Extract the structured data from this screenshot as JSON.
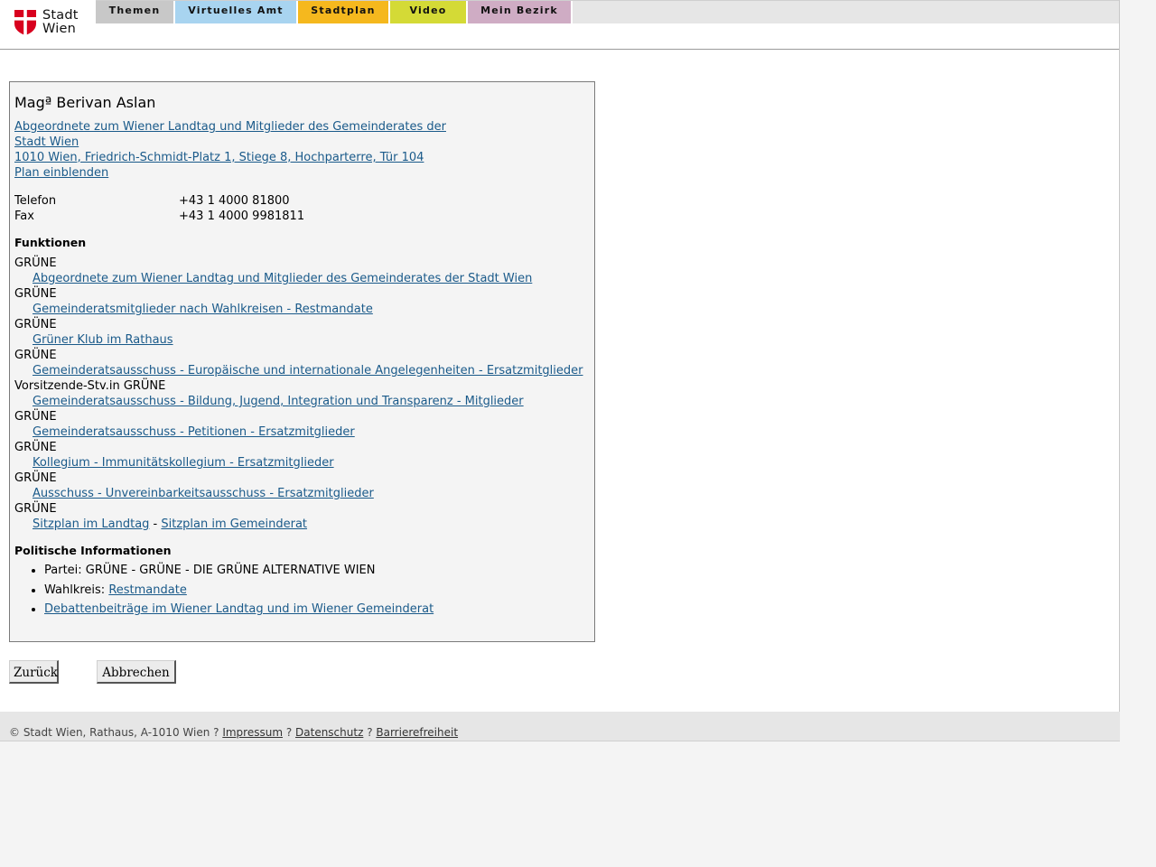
{
  "header": {
    "logo": {
      "line1": "Stadt",
      "line2": "Wien"
    },
    "nav": [
      "Themen",
      "Virtuelles Amt",
      "Stadtplan",
      "Video",
      "Mein Bezirk"
    ]
  },
  "person": {
    "name": "Magª Berivan Aslan",
    "org_line1": "Abgeordnete zum Wiener Landtag und Mitglieder des Gemeinderates der",
    "org_line2": "Stadt Wien ",
    "address": "1010 Wien, Friedrich-Schmidt-Platz 1, Stiege 8, Hochparterre, Tür 104",
    "plan_link": "Plan einblenden",
    "phone_label": "Telefon",
    "phone": "+43 1 4000 81800",
    "fax_label": "Fax",
    "fax": "+43 1 4000 9981811"
  },
  "functions": {
    "title": "Funktionen",
    "items": [
      {
        "role": "GRÜNE",
        "org": "Abgeordnete zum Wiener Landtag und Mitglieder des Gemeinderates der Stadt Wien"
      },
      {
        "role": "GRÜNE",
        "org": "Gemeinderatsmitglieder nach Wahlkreisen - Restmandate"
      },
      {
        "role": "GRÜNE",
        "org": "Grüner Klub im Rathaus"
      },
      {
        "role": "GRÜNE",
        "org": "Gemeinderatsausschuss - Europäische und internationale Angelegenheiten - Ersatzmitglieder"
      },
      {
        "role": "Vorsitzende-Stv.in GRÜNE",
        "org": "Gemeinderatsausschuss - Bildung, Jugend, Integration und Transparenz - Mitglieder"
      },
      {
        "role": "GRÜNE",
        "org": "Gemeinderatsausschuss - Petitionen - Ersatzmitglieder"
      },
      {
        "role": "GRÜNE",
        "org": "Kollegium - Immunitätskollegium - Ersatzmitglieder"
      },
      {
        "role": "GRÜNE",
        "org": "Ausschuss - Unvereinbarkeitsausschuss - Ersatzmitglieder"
      }
    ],
    "seating": {
      "role": "GRÜNE",
      "landtag": "Sitzplan im Landtag",
      "separator": " - ",
      "gemeinderat": "Sitzplan im Gemeinderat"
    }
  },
  "politics": {
    "title": "Politische Informationen",
    "party": "Partei: GRÜNE - GRÜNE - DIE GRÜNE ALTERNATIVE WIEN",
    "district_label": "Wahlkreis: ",
    "district_link": "Restmandate",
    "debates_link": "Debattenbeiträge im Wiener Landtag und im Wiener Gemeinderat"
  },
  "buttons": {
    "back": "Zurück",
    "cancel": "Abbrechen"
  },
  "footer": {
    "copyright": "© Stadt Wien, Rathaus, A-1010 Wien ? ",
    "imprint": "Impressum",
    "sep1": " ? ",
    "privacy": "Datenschutz",
    "sep2": " ? ",
    "accessibility": "Barrierefreiheit"
  },
  "colors": {
    "link": "#1a5a8a",
    "logo_red": "#d8001e",
    "tab_themen": "#c8c8c8",
    "tab_amt": "#a8d4f0",
    "tab_stadtplan": "#f5b81e",
    "tab_video": "#d4da36",
    "tab_bezirk": "#cfacc4"
  }
}
